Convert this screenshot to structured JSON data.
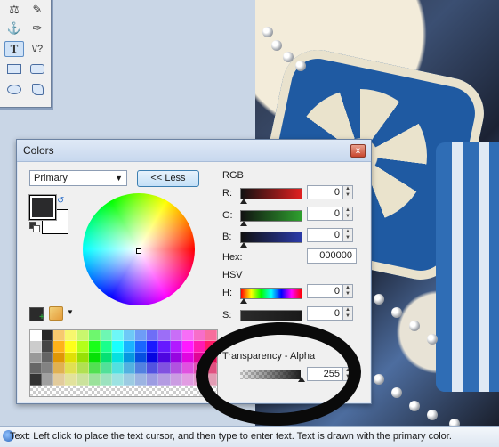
{
  "dialog": {
    "title": "Colors",
    "close_glyph": "x",
    "mode_select": "Primary",
    "less_button": "<< Less",
    "rgb_label": "RGB",
    "hsv_label": "HSV",
    "transparency_label": "Transparency - Alpha",
    "channels": [
      {
        "label": "R:",
        "value": "0"
      },
      {
        "label": "G:",
        "value": "0"
      },
      {
        "label": "B:",
        "value": "0"
      },
      {
        "label": "H:",
        "value": "0"
      },
      {
        "label": "S:",
        "value": "0"
      }
    ],
    "hex_label": "Hex:",
    "hex_value": "000000",
    "alpha_value": "255",
    "primary_color": "#2a2a2c",
    "secondary_color": "#ffffff"
  },
  "tools": {
    "items": [
      "paint-bucket-icon",
      "color-picker-icon",
      "clone-stamp-icon",
      "recolor-icon",
      "text-tool-icon",
      "line-curve-icon",
      "rectangle-icon",
      "rounded-rectangle-icon",
      "ellipse-icon",
      "freeform-shape-icon"
    ],
    "text_tool_glyph": "T",
    "line_tool_glyph": "\\/?"
  },
  "status": {
    "text": "Text: Left click to place the text cursor, and then type to enter text. Text is drawn with the primary color."
  }
}
